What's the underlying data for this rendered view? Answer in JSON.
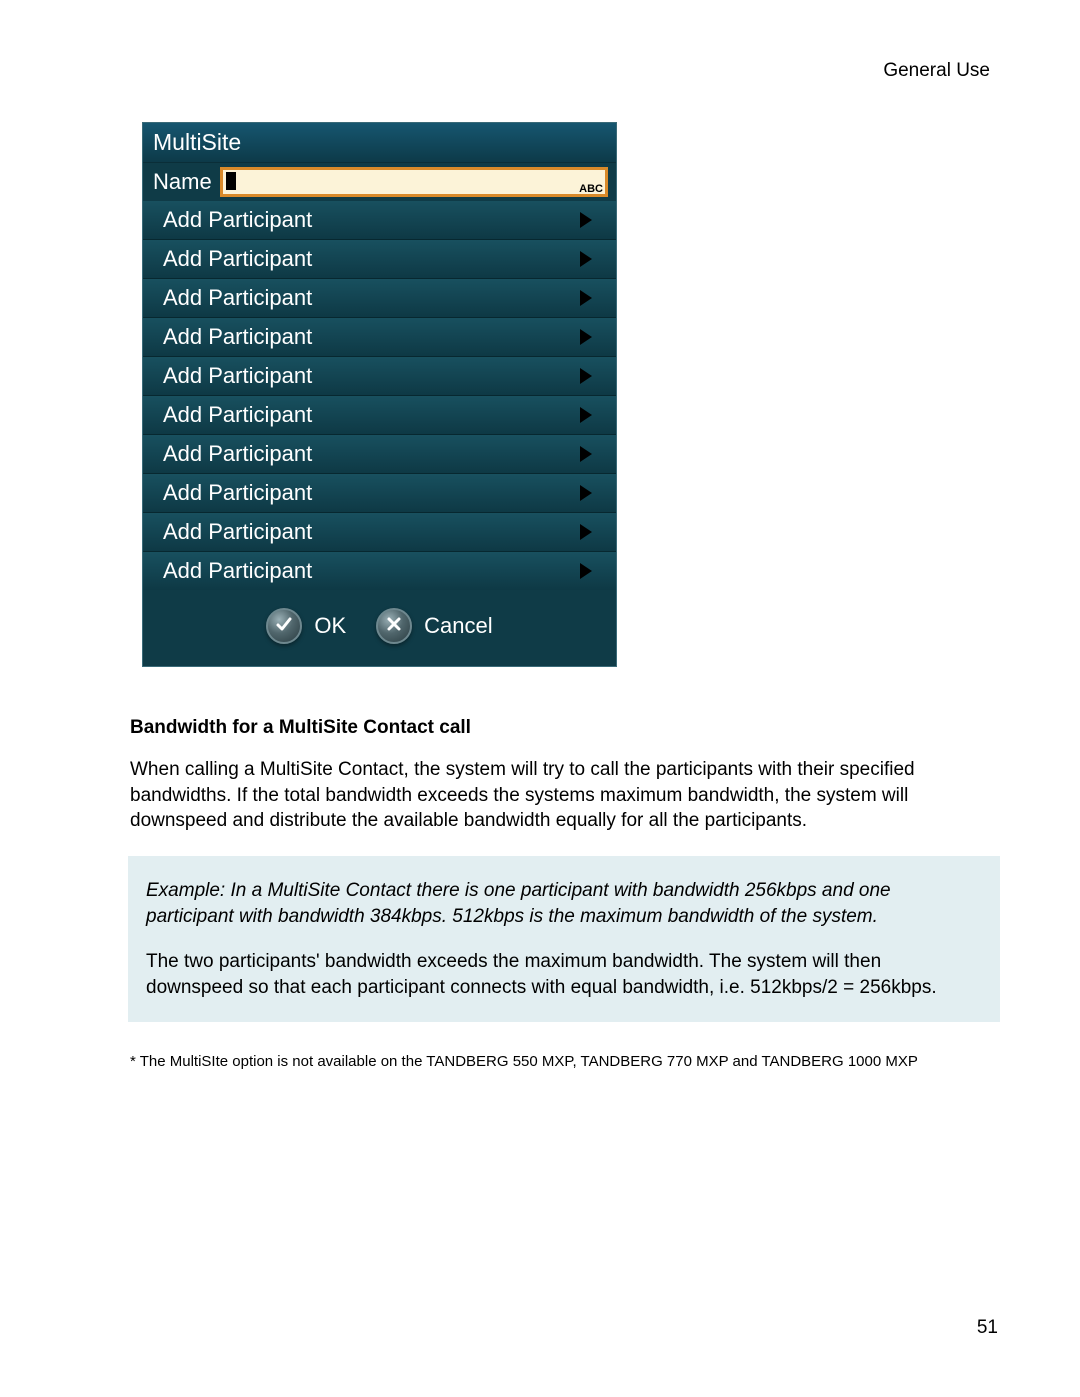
{
  "header": "General Use",
  "dialog": {
    "title": "MultiSite",
    "nameLabel": "Name",
    "nameValue": "",
    "inputModeBadge": "ABC",
    "participants": [
      "Add Participant",
      "Add Participant",
      "Add Participant",
      "Add Participant",
      "Add Participant",
      "Add Participant",
      "Add Participant",
      "Add Participant",
      "Add Participant",
      "Add Participant"
    ],
    "okLabel": "OK",
    "cancelLabel": "Cancel"
  },
  "section": {
    "heading": "Bandwidth for a MultiSite Contact call",
    "body": "When calling a MultiSite Contact, the system will try to call the participants with their specified bandwidths. If the total bandwidth exceeds the systems maximum bandwidth, the system will downspeed and distribute the available bandwidth equally for all the participants."
  },
  "example": {
    "italic": "Example:  In a MultiSite Contact there is one participant with bandwidth 256kbps and one participant with bandwidth 384kbps. 512kbps is the maximum bandwidth of the system.",
    "body": "The two participants' bandwidth exceeds the maximum bandwidth. The system will then downspeed so that each participant connects with equal bandwidth, i.e. 512kbps/2 = 256kbps."
  },
  "footnote": "* The MultiSIte option is not available on the TANDBERG 550 MXP, TANDBERG 770 MXP and TANDBERG 1000 MXP",
  "pageNumber": "51"
}
